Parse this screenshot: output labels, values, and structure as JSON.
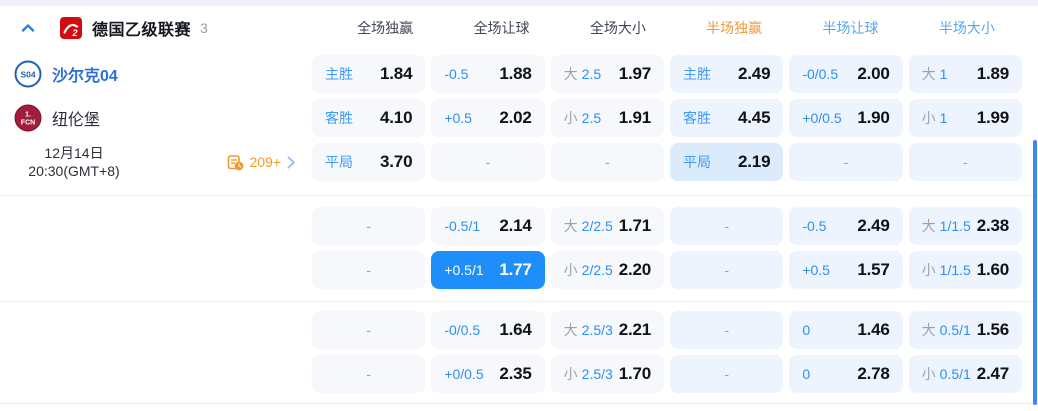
{
  "header": {
    "league": "德国乙级联赛",
    "count": "3"
  },
  "columns": [
    {
      "label": "全场独赢",
      "style": "dark"
    },
    {
      "label": "全场让球",
      "style": "dark"
    },
    {
      "label": "全场大小",
      "style": "dark"
    },
    {
      "label": "半场独赢",
      "style": "orange"
    },
    {
      "label": "半场让球",
      "style": "blue"
    },
    {
      "label": "半场大小",
      "style": "blue"
    }
  ],
  "match": {
    "home": {
      "name": "沙尔克04",
      "badge": "schalke04-badge"
    },
    "away": {
      "name": "纽伦堡",
      "badge": "nurnberg-badge"
    },
    "date_line1": "12月14日",
    "date_line2": "20:30(GMT+8)",
    "more_count": "209+"
  },
  "ui": {
    "dash": "-",
    "colors": {
      "selected_cell": "#1e8ffa",
      "label_blue": "#3e9bf4",
      "muted_gray": "#9aa1ac",
      "half_header_orange": "#f09a38",
      "half_header_blue": "#58a6f3",
      "home_team_blue": "#2a6fd9",
      "more_orange": "#f59b2b",
      "left_cell_bg": "#f6f8fb",
      "right_cell_bg": "#edf4fd"
    }
  },
  "sections": [
    {
      "rows": [
        {
          "info": "home",
          "cells": [
            {
              "pre": "主胜",
              "odds": "1.84"
            },
            {
              "line": "-0.5",
              "odds": "1.88"
            },
            {
              "pre": "大",
              "pre_muted": true,
              "line": "2.5",
              "odds": "1.97"
            },
            {
              "pre": "主胜",
              "odds": "2.49"
            },
            {
              "line": "-0/0.5",
              "odds": "2.00"
            },
            {
              "pre": "大",
              "pre_muted": true,
              "line": "1",
              "odds": "1.89"
            }
          ]
        },
        {
          "info": "away",
          "cells": [
            {
              "pre": "客胜",
              "odds": "4.10"
            },
            {
              "line": "+0.5",
              "odds": "2.02"
            },
            {
              "pre": "小",
              "pre_muted": true,
              "line": "2.5",
              "odds": "1.91"
            },
            {
              "pre": "客胜",
              "odds": "4.45"
            },
            {
              "line": "+0/0.5",
              "odds": "1.90"
            },
            {
              "pre": "小",
              "pre_muted": true,
              "line": "1",
              "odds": "1.99"
            }
          ]
        },
        {
          "info": "datetime",
          "cells": [
            {
              "pre": "平局",
              "odds": "3.70"
            },
            {
              "dash": true
            },
            {
              "dash": true
            },
            {
              "pre": "平局",
              "odds": "2.19",
              "accent": true
            },
            {
              "dash": true
            },
            {
              "dash": true
            }
          ]
        }
      ]
    },
    {
      "rows": [
        {
          "info": null,
          "cells": [
            {
              "dash": true
            },
            {
              "line": "-0.5/1",
              "odds": "2.14"
            },
            {
              "pre": "大",
              "pre_muted": true,
              "line": "2/2.5",
              "odds": "1.71"
            },
            {
              "dash": true
            },
            {
              "line": "-0.5",
              "odds": "2.49"
            },
            {
              "pre": "大",
              "pre_muted": true,
              "line": "1/1.5",
              "odds": "2.38"
            }
          ]
        },
        {
          "info": null,
          "cells": [
            {
              "dash": true
            },
            {
              "line": "+0.5/1",
              "odds": "1.77",
              "selected": true
            },
            {
              "pre": "小",
              "pre_muted": true,
              "line": "2/2.5",
              "odds": "2.20"
            },
            {
              "dash": true
            },
            {
              "line": "+0.5",
              "odds": "1.57"
            },
            {
              "pre": "小",
              "pre_muted": true,
              "line": "1/1.5",
              "odds": "1.60"
            }
          ]
        }
      ]
    },
    {
      "rows": [
        {
          "info": null,
          "cells": [
            {
              "dash": true
            },
            {
              "line": "-0/0.5",
              "odds": "1.64"
            },
            {
              "pre": "大",
              "pre_muted": true,
              "line": "2.5/3",
              "odds": "2.21"
            },
            {
              "dash": true
            },
            {
              "line": "0",
              "odds": "1.46"
            },
            {
              "pre": "大",
              "pre_muted": true,
              "line": "0.5/1",
              "odds": "1.56"
            }
          ]
        },
        {
          "info": null,
          "cells": [
            {
              "dash": true
            },
            {
              "line": "+0/0.5",
              "odds": "2.35"
            },
            {
              "pre": "小",
              "pre_muted": true,
              "line": "2.5/3",
              "odds": "1.70"
            },
            {
              "dash": true
            },
            {
              "line": "0",
              "odds": "2.78"
            },
            {
              "pre": "小",
              "pre_muted": true,
              "line": "0.5/1",
              "odds": "2.47"
            }
          ]
        }
      ]
    }
  ]
}
